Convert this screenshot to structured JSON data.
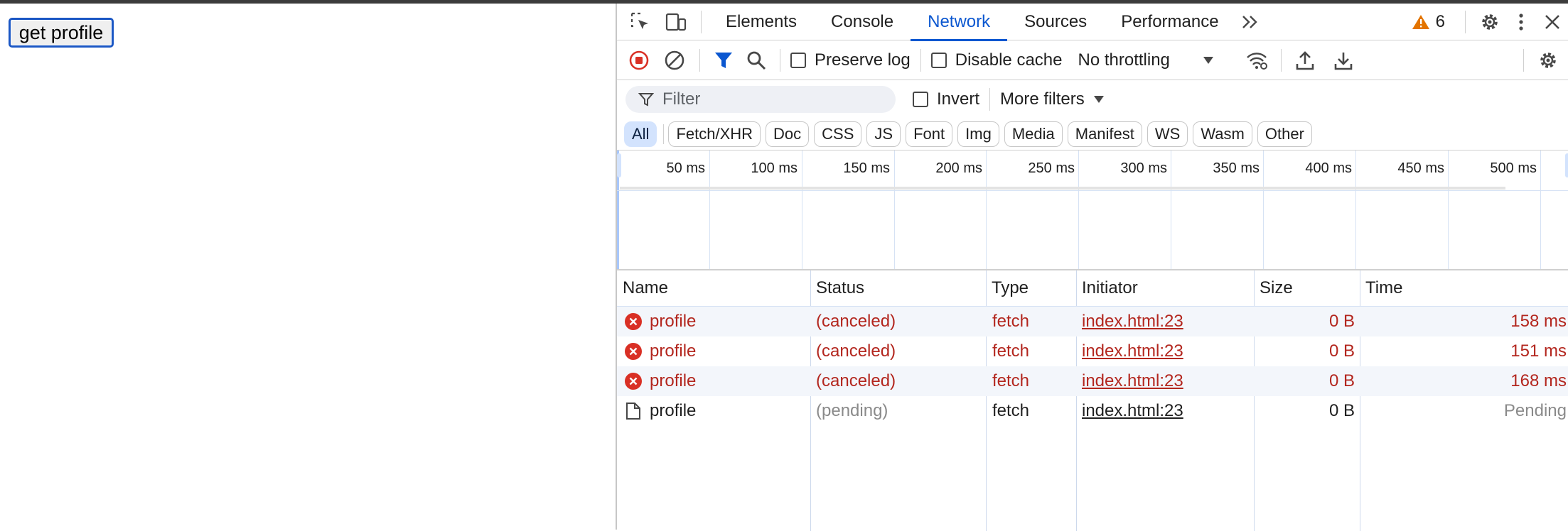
{
  "page": {
    "get_profile_label": "get profile"
  },
  "devtools": {
    "tabs": [
      "Elements",
      "Console",
      "Network",
      "Sources",
      "Performance"
    ],
    "active_tab": "Network",
    "issues_count": "6",
    "toolbar": {
      "preserve_log": "Preserve log",
      "disable_cache": "Disable cache",
      "throttling": "No throttling"
    },
    "filter": {
      "placeholder": "Filter",
      "invert": "Invert",
      "more_filters": "More filters"
    },
    "type_filters": [
      "All",
      "Fetch/XHR",
      "Doc",
      "CSS",
      "JS",
      "Font",
      "Img",
      "Media",
      "Manifest",
      "WS",
      "Wasm",
      "Other"
    ],
    "active_type": "All",
    "timeline_ticks": [
      "50 ms",
      "100 ms",
      "150 ms",
      "200 ms",
      "250 ms",
      "300 ms",
      "350 ms",
      "400 ms",
      "450 ms",
      "500 ms"
    ],
    "columns": [
      "Name",
      "Status",
      "Type",
      "Initiator",
      "Size",
      "Time"
    ],
    "rows": [
      {
        "name": "profile",
        "status": "(canceled)",
        "type": "fetch",
        "initiator": "index.html:23",
        "size": "0 B",
        "time": "158 ms",
        "state": "error"
      },
      {
        "name": "profile",
        "status": "(canceled)",
        "type": "fetch",
        "initiator": "index.html:23",
        "size": "0 B",
        "time": "151 ms",
        "state": "error"
      },
      {
        "name": "profile",
        "status": "(canceled)",
        "type": "fetch",
        "initiator": "index.html:23",
        "size": "0 B",
        "time": "168 ms",
        "state": "error"
      },
      {
        "name": "profile",
        "status": "(pending)",
        "type": "fetch",
        "initiator": "index.html:23",
        "size": "0 B",
        "time": "Pending",
        "state": "pending"
      }
    ]
  },
  "colors": {
    "accent": "#0b57d0",
    "error": "#b3261e",
    "record": "#d93025"
  }
}
